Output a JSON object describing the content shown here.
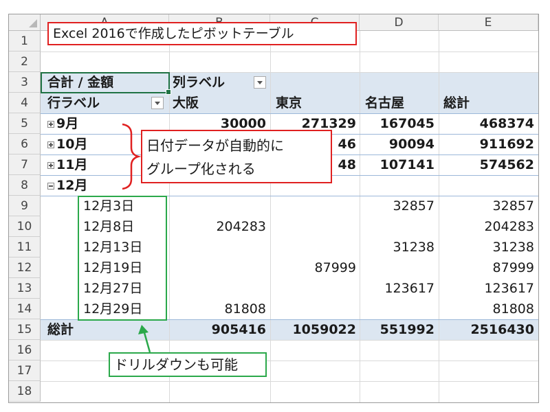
{
  "columns": [
    "A",
    "B",
    "C",
    "D",
    "E"
  ],
  "rows": [
    "1",
    "2",
    "3",
    "4",
    "5",
    "6",
    "7",
    "8",
    "9",
    "10",
    "11",
    "12",
    "13",
    "14",
    "15",
    "16",
    "17",
    "18"
  ],
  "title_callout": "Excel 2016で作成したピボットテーブル",
  "pivot": {
    "sum_label": "合計 / 金額",
    "col_label": "列ラベル",
    "row_label": "行ラベル",
    "col_headers": [
      "大阪",
      "東京",
      "名古屋",
      "総計"
    ],
    "month_rows": [
      {
        "label": "9月",
        "values": [
          "30000",
          "271329",
          "167045",
          "468374"
        ]
      },
      {
        "label": "10月",
        "values": [
          "",
          "46",
          "90094",
          "911692"
        ]
      },
      {
        "label": "11月",
        "values": [
          "",
          "48",
          "107141",
          "574562"
        ]
      }
    ],
    "dec_label": "12月",
    "date_rows": [
      {
        "label": "12月3日",
        "values": [
          "",
          "",
          "32857",
          "32857"
        ]
      },
      {
        "label": "12月8日",
        "values": [
          "204283",
          "",
          "",
          "204283"
        ]
      },
      {
        "label": "12月13日",
        "values": [
          "",
          "",
          "31238",
          "31238"
        ]
      },
      {
        "label": "12月19日",
        "values": [
          "",
          "87999",
          "",
          "87999"
        ]
      },
      {
        "label": "12月27日",
        "values": [
          "",
          "",
          "123617",
          "123617"
        ]
      },
      {
        "label": "12月29日",
        "values": [
          "81808",
          "",
          "",
          "81808"
        ]
      }
    ],
    "total_label": "総計",
    "total_values": [
      "905416",
      "1059022",
      "551992",
      "2516430"
    ]
  },
  "callout_group": {
    "line1": "日付データが自動的に",
    "line2": "グループ化される"
  },
  "callout_drill": "ドリルダウンも可能",
  "colors": {
    "red": "#e02020",
    "green": "#2aa84a",
    "band": "#dce6f1"
  }
}
